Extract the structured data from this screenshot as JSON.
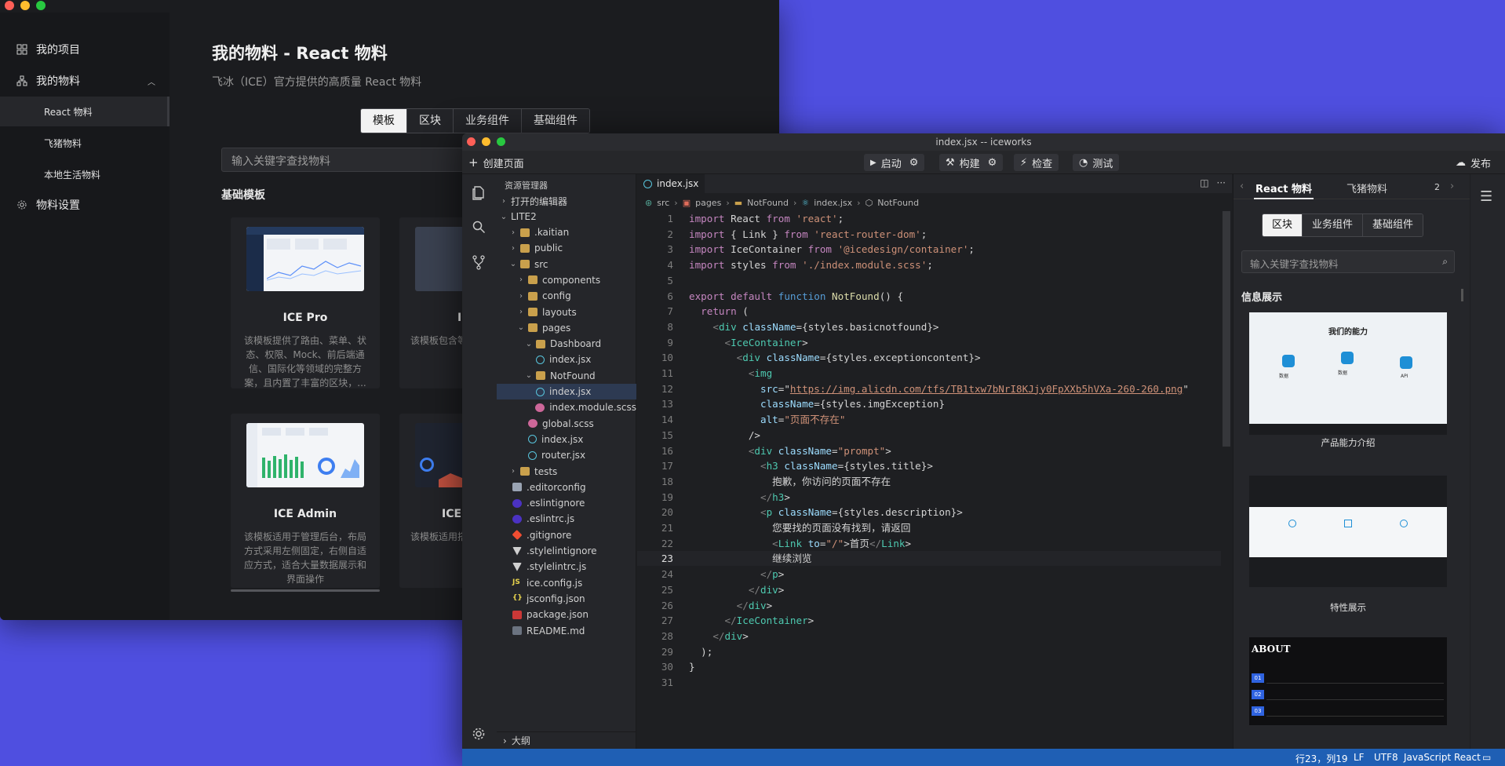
{
  "back_window": {
    "sidebar": {
      "items": [
        {
          "label": "我的项目",
          "icon": "grid-icon"
        },
        {
          "label": "我的物料",
          "icon": "org-icon"
        },
        {
          "label": "物料设置",
          "icon": "gear-icon"
        }
      ],
      "sub_items": [
        {
          "label": "React 物料",
          "active": true
        },
        {
          "label": "飞猪物料",
          "active": false
        },
        {
          "label": "本地生活物料",
          "active": false
        }
      ]
    },
    "title": "我的物料 - React 物料",
    "description": "飞冰（ICE）官方提供的高质量 React 物料",
    "tabs": [
      {
        "label": "模板",
        "active": true
      },
      {
        "label": "区块",
        "active": false
      },
      {
        "label": "业务组件",
        "active": false
      },
      {
        "label": "基础组件",
        "active": false
      }
    ],
    "search_placeholder": "输入关键字查找物料",
    "section_title": "基础模板",
    "cards": [
      {
        "name": "ICE Pro",
        "desc": "该模板提供了路由、菜单、状态、权限、Mock、前后端通信、国际化等领域的完整方案，且内置了丰富的区块，..."
      },
      {
        "name": "IC",
        "desc": "该模板包含等，适合比"
      },
      {
        "name": "ICE Admin",
        "desc": "该模板适用于管理后台，布局方式采用左侧固定，右侧自适应方式，适合大量数据展示和界面操作"
      },
      {
        "name": "ICE",
        "desc": "该模板适用搭配简洁的表"
      }
    ]
  },
  "ide": {
    "window_title": "index.jsx -- iceworks",
    "toolbar": {
      "create_page": "创建页面",
      "start": "启动",
      "build": "构建",
      "check": "检查",
      "test": "测试",
      "publish": "发布"
    },
    "explorer": {
      "header": "资源管理器",
      "open_editors": "打开的编辑器",
      "root": "LITE2",
      "outline": "大纲",
      "rows": [
        {
          "label": ".kaitian",
          "indent": 1,
          "type": "folder",
          "arrow": "›"
        },
        {
          "label": "public",
          "indent": 1,
          "type": "folder",
          "arrow": "›"
        },
        {
          "label": "src",
          "indent": 1,
          "type": "folder",
          "arrow": "⌄"
        },
        {
          "label": "components",
          "indent": 2,
          "type": "folder",
          "arrow": "›"
        },
        {
          "label": "config",
          "indent": 2,
          "type": "folder",
          "arrow": "›"
        },
        {
          "label": "layouts",
          "indent": 2,
          "type": "folder",
          "arrow": "›"
        },
        {
          "label": "pages",
          "indent": 2,
          "type": "folder",
          "arrow": "⌄"
        },
        {
          "label": "Dashboard",
          "indent": 3,
          "type": "folder",
          "arrow": "⌄"
        },
        {
          "label": "index.jsx",
          "indent": 3,
          "type": "react",
          "arrow": ""
        },
        {
          "label": "NotFound",
          "indent": 3,
          "type": "folder",
          "arrow": "⌄"
        },
        {
          "label": "index.jsx",
          "indent": 3,
          "type": "react",
          "arrow": "",
          "active": true
        },
        {
          "label": "index.module.scss",
          "indent": 3,
          "type": "scss",
          "arrow": ""
        },
        {
          "label": "global.scss",
          "indent": 2,
          "type": "scss",
          "arrow": ""
        },
        {
          "label": "index.jsx",
          "indent": 2,
          "type": "react",
          "arrow": ""
        },
        {
          "label": "router.jsx",
          "indent": 2,
          "type": "react",
          "arrow": ""
        },
        {
          "label": "tests",
          "indent": 1,
          "type": "folder",
          "arrow": "›"
        },
        {
          "label": ".editorconfig",
          "indent": 0,
          "type": "cfg",
          "arrow": ""
        },
        {
          "label": ".eslintignore",
          "indent": 0,
          "type": "eslint",
          "arrow": ""
        },
        {
          "label": ".eslintrc.js",
          "indent": 0,
          "type": "eslint",
          "arrow": ""
        },
        {
          "label": ".gitignore",
          "indent": 0,
          "type": "git",
          "arrow": ""
        },
        {
          "label": ".stylelintignore",
          "indent": 0,
          "type": "style",
          "arrow": ""
        },
        {
          "label": ".stylelintrc.js",
          "indent": 0,
          "type": "style",
          "arrow": ""
        },
        {
          "label": "ice.config.js",
          "indent": 0,
          "type": "js",
          "arrow": ""
        },
        {
          "label": "jsconfig.json",
          "indent": 0,
          "type": "json",
          "arrow": ""
        },
        {
          "label": "package.json",
          "indent": 0,
          "type": "npm",
          "arrow": ""
        },
        {
          "label": "README.md",
          "indent": 0,
          "type": "md",
          "arrow": ""
        }
      ]
    },
    "editor": {
      "tab_label": "index.jsx",
      "breadcrumb": [
        "src",
        "pages",
        "NotFound",
        "index.jsx",
        "NotFound"
      ],
      "current_line": 23,
      "code_lines": [
        "import React from 'react';",
        "import { Link } from 'react-router-dom';",
        "import IceContainer from '@icedesign/container';",
        "import styles from './index.module.scss';",
        "",
        "export default function NotFound() {",
        "  return (",
        "    <div className={styles.basicnotfound}>",
        "      <IceContainer>",
        "        <div className={styles.exceptioncontent}>",
        "          <img",
        "            src=\"https://img.alicdn.com/tfs/TB1txw7bNrI8KJjy0FpXXb5hVXa-260-260.png\"",
        "            className={styles.imgException}",
        "            alt=\"页面不存在\"",
        "          />",
        "          <div className=\"prompt\">",
        "            <h3 className={styles.title}>",
        "              抱歉，你访问的页面不存在",
        "            </h3>",
        "            <p className={styles.description}>",
        "              您要找的页面没有找到，请返回",
        "              <Link to=\"/\">首页</Link>",
        "              继续浏览",
        "            </p>",
        "          </div>",
        "        </div>",
        "      </IceContainer>",
        "    </div>",
        "  );",
        "}",
        ""
      ]
    },
    "right_panel": {
      "tabs": [
        "React 物料",
        "飞猪物料"
      ],
      "tab_count": "2",
      "segments": [
        {
          "label": "区块",
          "active": true
        },
        {
          "label": "业务组件",
          "active": false
        },
        {
          "label": "基础组件",
          "active": false
        }
      ],
      "search_placeholder": "输入关键字查找物料",
      "section_title": "信息展示",
      "cards": [
        {
          "title": "产品能力介绍",
          "preview_heading": "我们的能力",
          "preview_items": [
            "数据",
            "数据",
            "API"
          ]
        },
        {
          "title": "特性展示"
        },
        {
          "title": "",
          "preview_heading": "ABOUT",
          "preview_rows": [
            "01",
            "02",
            "03"
          ]
        }
      ]
    },
    "status_bar": {
      "position": "行23，列19",
      "eol": "LF",
      "encoding": "UTF8",
      "language": "JavaScript React"
    }
  }
}
